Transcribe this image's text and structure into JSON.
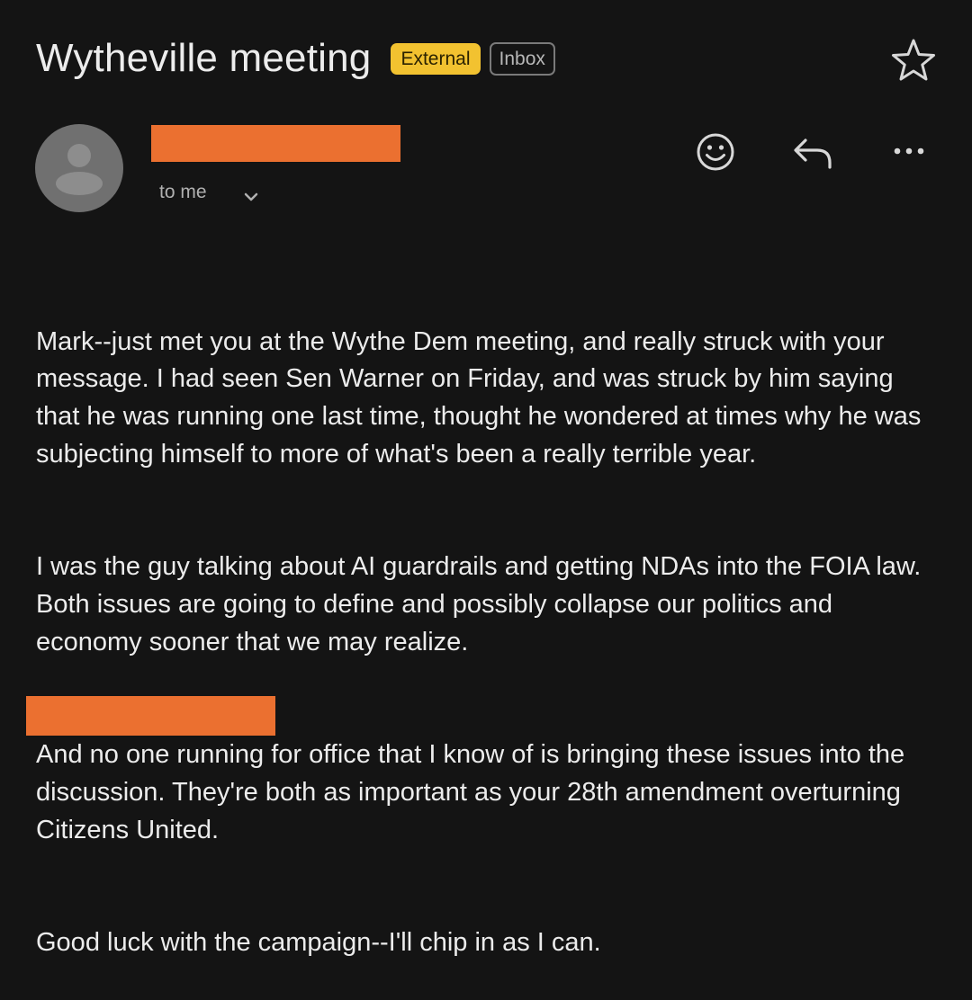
{
  "email": {
    "subject": "Wytheville meeting",
    "labels": {
      "external": "External",
      "inbox": "Inbox"
    },
    "recipient_line": "to me",
    "body_paragraphs": [
      "Mark--just met you at the Wythe Dem meeting, and really struck with your message. I had seen Sen Warner on Friday, and was struck by him saying  that he was running one last time, thought he wondered at times why he was subjecting himself to more of what's been a really terrible year.",
      "I was the guy talking about AI guardrails and getting NDAs into the FOIA law. Both issues are going to define and possibly collapse our politics and economy sooner that we may realize.",
      "And no one running for office that I know of is bringing these issues into the discussion. They're both as important as your 28th amendment overturning Citizens United.",
      "Good luck with the campaign--I'll chip in as I can."
    ]
  },
  "icons": {
    "star": "star-icon",
    "avatar": "person-icon",
    "expand_recipients": "chevron-down-icon",
    "emoji_reaction": "smiley-icon",
    "reply": "reply-icon",
    "more": "more-horizontal-icon"
  },
  "colors": {
    "background": "#141414",
    "redaction": "#eb7030",
    "external_label": "#f2c230",
    "text": "#ececec",
    "muted_text": "#b0b0b0"
  }
}
